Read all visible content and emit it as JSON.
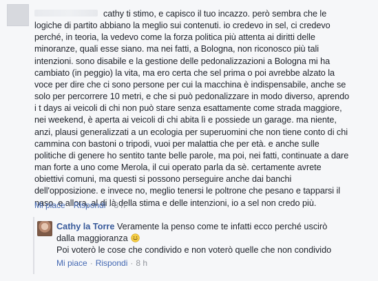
{
  "comment": {
    "lines": [
      "cathy ti stimo, e capisco il tuo incazzo. però sembra che le",
      "logiche di partito abbiano la meglio sui contenuti. io credevo in sel, ci credevo",
      "perché, in teoria, la vedevo come la forza politica più attenta ai diritti delle",
      "minoranze, quali esse siano. ma nei fatti, a Bologna, non riconosco più tali",
      "intenzioni. sono disabile e la gestione delle pedonalizzazioni a Bologna mi ha",
      "cambiato (in peggio) la vita, ma ero certa che sel prima o poi avrebbe alzato la",
      "voce per dire che ci sono persone per cui la macchina è indispensabile, anche se",
      "solo per percorrere 10 metri, e che si può pedonalizzare in modo diverso, aprendo",
      "i t days ai veicoli di chi non può stare senza esattamente come strada maggiore,",
      "nei weekend, è aperta ai veicoli di chi abita lì e possiede un garage. ma niente,",
      "anzi, plausi generalizzati a un ecologia per superuomini che non tiene conto di chi",
      "cammina con bastoni o tripodi, vuoi per malattia che per età. e anche sulle",
      "politiche di genere ho sentito tante belle parole, ma poi, nei fatti, continuate a dare",
      "man forte a uno come Merola, il cui operato parla da sè. certamente avrete",
      "obiettivi comuni, ma questi si possono perseguire anche dai banchi",
      "dell'opposizione. e invece no, meglio tenersi le poltrone che pesano e tapparsi il",
      "naso. e allora, al di là della stima e delle intenzioni, io a sel non credo più."
    ],
    "like_label": "Mi piace",
    "reply_label": "Rispondi",
    "time": "8 h"
  },
  "reply": {
    "author": "Cathy la Torre",
    "line1": "Veramente la penso come te infatti ecco perché uscirò",
    "line2": "dalla maggioranza",
    "emoji_icon": "smiley-face-icon",
    "line3": "Poi voterò le cose che condivido e non voterò quelle che non condivido",
    "like_label": "Mi piace",
    "reply_label": "Rispondi",
    "time": "8 h"
  },
  "colors": {
    "background": "#f6f7f9",
    "text": "#1d2129",
    "link": "#4267b2",
    "author": "#365899",
    "meta": "#90949c"
  }
}
